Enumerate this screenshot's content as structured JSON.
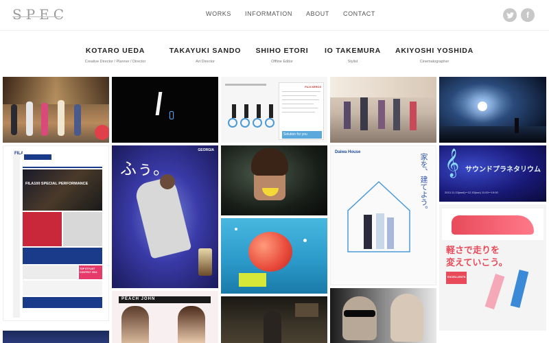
{
  "brand": {
    "logo_text": "SPEC"
  },
  "nav": {
    "items": [
      {
        "label": "WORKS"
      },
      {
        "label": "INFORMATION"
      },
      {
        "label": "ABOUT"
      },
      {
        "label": "CONTACT"
      }
    ]
  },
  "social": {
    "twitter_glyph": "t",
    "facebook_glyph": "f"
  },
  "team": [
    {
      "name": "KOTARO UEDA",
      "role": "Creative Director / Planner / Director"
    },
    {
      "name": "TAKAYUKI SANDO",
      "role": "Art Director"
    },
    {
      "name": "SHIHO ETORI",
      "role": "Offline Editor"
    },
    {
      "name": "IO TAKEMURA",
      "role": "Stylist"
    },
    {
      "name": "AKIYOSHI YOSHIDA",
      "role": "Cinematographer"
    }
  ],
  "tiles": {
    "t3_caption": "Solution for you",
    "t3_brand": "FUJI XEROX",
    "t6_brand": "FILA",
    "t6_banner": "FILA100 SPECIAL PERFORMANCE",
    "t6_contest": "TOP STYLIST CONTEST 2014",
    "t7_brand": "GEORGIA",
    "t7_kana": "ふぅ。",
    "t10_brand": "Daiwa House",
    "t10_copy": "家を、建てよう。",
    "t11_title": "サウンドプラネタリウム",
    "t11_date": "2013.11.13(wed)〜12.15(sun) 11:00〜19:00",
    "t12_copy1": "軽さで走りを",
    "t12_copy2": "変えていこう。",
    "t12_badge": "EXCELLENTS",
    "t13_title": "PEACH JOHN"
  },
  "colors": {
    "accent": "#c8c8c8",
    "text_dark": "#222222"
  }
}
